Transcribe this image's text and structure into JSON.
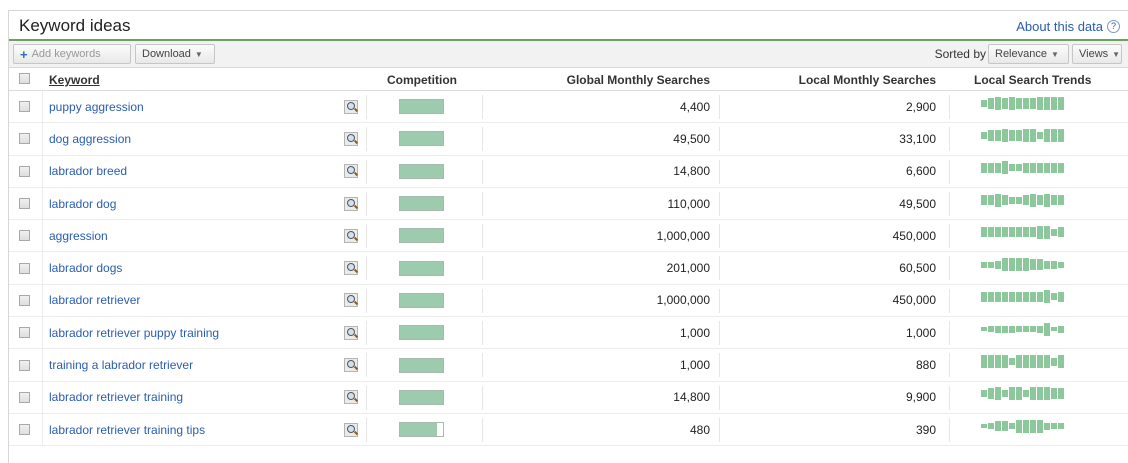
{
  "header": {
    "title": "Keyword ideas",
    "about_label": "About this data",
    "help_glyph": "?"
  },
  "toolbar": {
    "add_label": "Add keywords",
    "download_label": "Download",
    "sorted_by_label": "Sorted by",
    "sort_value": "Relevance",
    "views_label": "Views"
  },
  "columns": {
    "keyword": "Keyword",
    "competition": "Competition",
    "global": "Global Monthly Searches",
    "local": "Local Monthly Searches",
    "trends": "Local Search Trends"
  },
  "colors": {
    "accent_green": "#6aa35e",
    "competition_fill": "#9ccbae",
    "trend_bar": "#8cc89c",
    "link": "#2a5db0"
  },
  "rows": [
    {
      "keyword": "puppy aggression",
      "competition": 1.0,
      "global": "4,400",
      "local": "2,900",
      "trend": [
        0.5,
        0.75,
        0.9,
        0.75,
        0.9,
        0.75,
        0.75,
        0.75,
        0.9,
        0.9,
        0.9,
        0.9
      ]
    },
    {
      "keyword": "dog aggression",
      "competition": 1.0,
      "global": "49,500",
      "local": "33,100",
      "trend": [
        0.5,
        0.75,
        0.75,
        0.9,
        0.75,
        0.75,
        0.9,
        0.9,
        0.5,
        0.9,
        0.9,
        0.9
      ]
    },
    {
      "keyword": "labrador breed",
      "competition": 1.0,
      "global": "14,800",
      "local": "6,600",
      "trend": [
        0.7,
        0.7,
        0.7,
        0.9,
        0.5,
        0.5,
        0.7,
        0.7,
        0.7,
        0.7,
        0.7,
        0.7
      ]
    },
    {
      "keyword": "labrador dog",
      "competition": 1.0,
      "global": "110,000",
      "local": "49,500",
      "trend": [
        0.7,
        0.7,
        0.9,
        0.7,
        0.5,
        0.5,
        0.7,
        0.9,
        0.7,
        0.9,
        0.7,
        0.7
      ]
    },
    {
      "keyword": "aggression",
      "competition": 1.0,
      "global": "1,000,000",
      "local": "450,000",
      "trend": [
        0.7,
        0.7,
        0.7,
        0.7,
        0.7,
        0.7,
        0.7,
        0.7,
        0.9,
        0.9,
        0.5,
        0.7
      ]
    },
    {
      "keyword": "labrador dogs",
      "competition": 1.0,
      "global": "201,000",
      "local": "60,500",
      "trend": [
        0.4,
        0.4,
        0.6,
        0.9,
        0.9,
        0.9,
        0.9,
        0.8,
        0.8,
        0.6,
        0.6,
        0.4
      ]
    },
    {
      "keyword": "labrador retriever",
      "competition": 1.0,
      "global": "1,000,000",
      "local": "450,000",
      "trend": [
        0.7,
        0.7,
        0.7,
        0.7,
        0.7,
        0.7,
        0.7,
        0.7,
        0.7,
        0.9,
        0.5,
        0.7
      ]
    },
    {
      "keyword": "labrador retriever puppy training",
      "competition": 1.0,
      "global": "1,000",
      "local": "1,000",
      "trend": [
        0.3,
        0.4,
        0.5,
        0.5,
        0.5,
        0.4,
        0.4,
        0.4,
        0.5,
        0.9,
        0.3,
        0.5
      ]
    },
    {
      "keyword": "training a labrador retriever",
      "competition": 1.0,
      "global": "1,000",
      "local": "880",
      "trend": [
        0.9,
        0.9,
        0.9,
        0.9,
        0.5,
        0.9,
        0.9,
        0.9,
        0.9,
        0.9,
        0.6,
        0.9
      ]
    },
    {
      "keyword": "labrador retriever training",
      "competition": 1.0,
      "global": "14,800",
      "local": "9,900",
      "trend": [
        0.5,
        0.8,
        0.9,
        0.5,
        0.9,
        0.9,
        0.5,
        0.9,
        0.9,
        0.9,
        0.8,
        0.8
      ]
    },
    {
      "keyword": "labrador retriever training tips",
      "competition": 0.85,
      "global": "480",
      "local": "390",
      "trend": [
        0.3,
        0.4,
        0.7,
        0.7,
        0.4,
        0.9,
        0.9,
        0.9,
        0.9,
        0.5,
        0.4,
        0.4
      ]
    }
  ]
}
